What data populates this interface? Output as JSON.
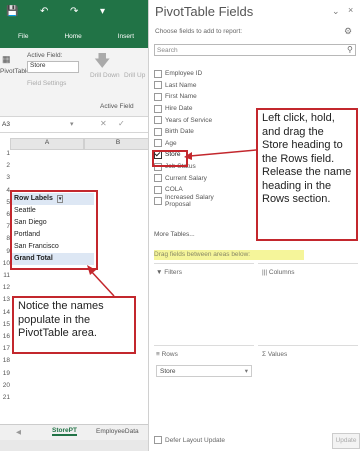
{
  "excel": {
    "tabs": [
      "File",
      "Home",
      "Insert"
    ],
    "ribbon": {
      "active_field_label": "Active Field:",
      "active_field_value": "Store",
      "field_settings": "Field Settings",
      "drill_down": "Drill Down",
      "drill_up": "Drill Up",
      "pivottable_label": "PivotTable",
      "group_label": "Active Field"
    },
    "name_box": "A3",
    "columns": [
      "A",
      "B"
    ],
    "row_numbers": [
      "1",
      "2",
      "3",
      "4",
      "5",
      "6",
      "7",
      "8",
      "9",
      "10",
      "11",
      "12",
      "13",
      "14",
      "15",
      "16",
      "17",
      "18",
      "19",
      "20",
      "21"
    ],
    "pivot_rows": {
      "header": "Row Labels",
      "items": [
        "Seattle",
        "San Diego",
        "Portland",
        "San Francisco"
      ],
      "grand_total": "Grand Total"
    },
    "sheet_tabs": [
      "StorePT",
      "EmployeeData"
    ]
  },
  "panel": {
    "title": "PivotTable Fields",
    "subtitle": "Choose fields to add to report:",
    "search_placeholder": "Search",
    "fields": [
      {
        "name": "Employee ID",
        "checked": false
      },
      {
        "name": "Last Name",
        "checked": false
      },
      {
        "name": "First Name",
        "checked": false
      },
      {
        "name": "Hire Date",
        "checked": false
      },
      {
        "name": "Years of Service",
        "checked": false
      },
      {
        "name": "Birth Date",
        "checked": false
      },
      {
        "name": "Age",
        "checked": false
      },
      {
        "name": "Store",
        "checked": true
      },
      {
        "name": "Job Status",
        "checked": false
      },
      {
        "name": "Current Salary",
        "checked": false
      },
      {
        "name": "COLA",
        "checked": false
      },
      {
        "name": "Increased Salary Proposal",
        "checked": false
      }
    ],
    "more_tables": "More Tables...",
    "drag_hint": "Drag fields between areas below:",
    "areas": {
      "filters": "Filters",
      "columns": "Columns",
      "rows": "Rows",
      "values": "Values"
    },
    "rows_items": [
      "Store"
    ],
    "defer_label": "Defer Layout Update",
    "update_label": "Update"
  },
  "callouts": {
    "right": "Left click, hold, and drag the Store heading to the Rows field. Release the name heading in the Rows section.",
    "left": "Notice the names populate in the PivotTable area."
  },
  "colors": {
    "excel_green": "#217346",
    "callout_red": "#c3272d",
    "highlight_yellow": "#f5f59a"
  }
}
